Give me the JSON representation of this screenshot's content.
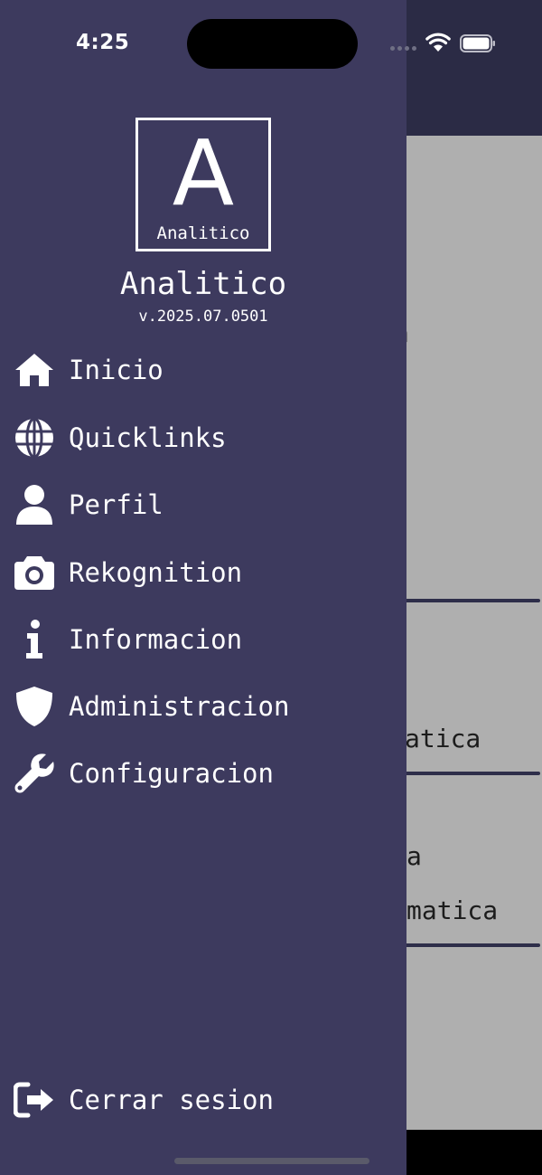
{
  "status_bar": {
    "time": "4:25"
  },
  "background": {
    "texts": [
      "n",
      "atica",
      "a",
      "matica"
    ]
  },
  "drawer": {
    "logo_letter": "A",
    "logo_subtitle": "Analitico",
    "app_name": "Analitico",
    "version": "v.2025.07.0501",
    "menu": [
      {
        "label": "Inicio",
        "icon": "home-icon"
      },
      {
        "label": "Quicklinks",
        "icon": "globe-icon"
      },
      {
        "label": "Perfil",
        "icon": "user-icon"
      },
      {
        "label": "Rekognition",
        "icon": "camera-icon"
      },
      {
        "label": "Informacion",
        "icon": "info-icon"
      },
      {
        "label": "Administracion",
        "icon": "shield-icon"
      },
      {
        "label": "Configuracion",
        "icon": "wrench-icon"
      }
    ],
    "logout": {
      "label": "Cerrar sesion",
      "icon": "logout-icon"
    }
  },
  "colors": {
    "drawer_bg": "#3d3a5e",
    "header_bg": "#2b2b45",
    "content_bg": "#afafaf"
  }
}
